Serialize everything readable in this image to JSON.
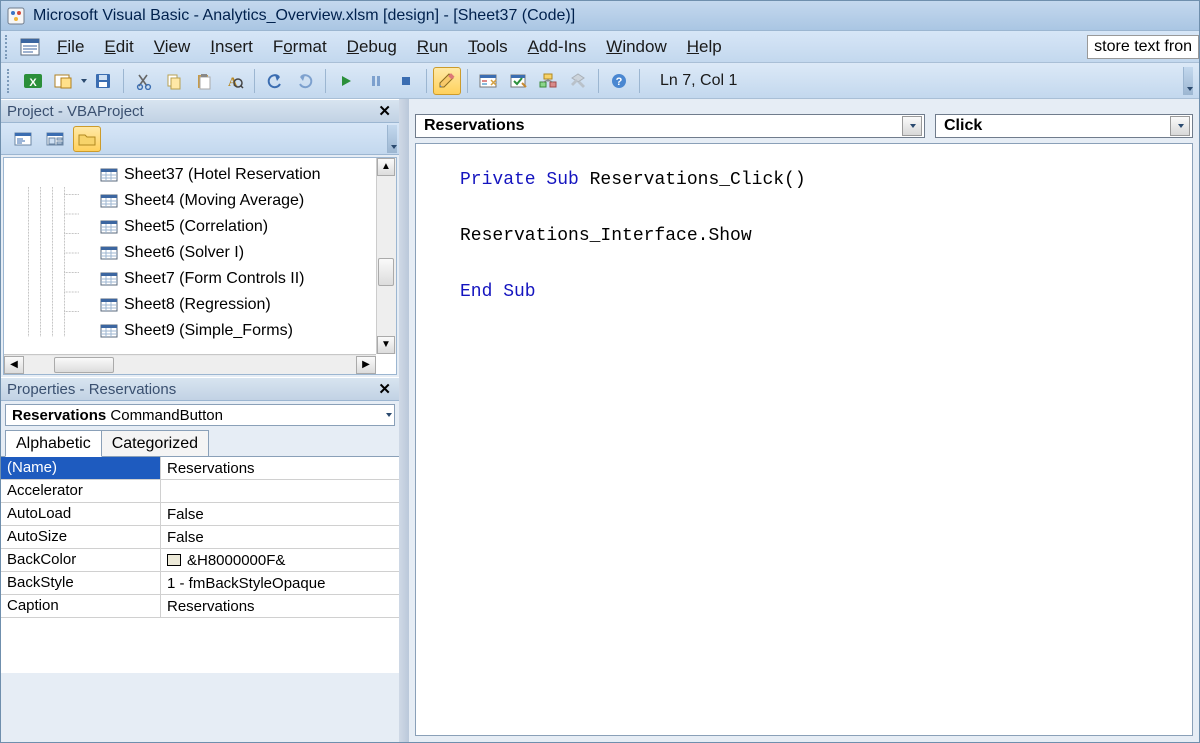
{
  "titlebar": "Microsoft Visual Basic - Analytics_Overview.xlsm [design] - [Sheet37 (Code)]",
  "menus": {
    "file": "File",
    "edit": "Edit",
    "view": "View",
    "insert": "Insert",
    "format": "Format",
    "debug": "Debug",
    "run": "Run",
    "tools": "Tools",
    "addins": "Add-Ins",
    "window": "Window",
    "help": "Help"
  },
  "tooltip_overflow": "store text fron",
  "toolbar_status": "Ln 7, Col 1",
  "project_panel": {
    "title": "Project - VBAProject",
    "items": [
      "Sheet37 (Hotel Reservation",
      "Sheet4 (Moving Average)",
      "Sheet5 (Correlation)",
      "Sheet6 (Solver I)",
      "Sheet7 (Form Controls II)",
      "Sheet8 (Regression)",
      "Sheet9 (Simple_Forms)"
    ]
  },
  "properties_panel": {
    "title": "Properties - Reservations",
    "selector_name": "Reservations",
    "selector_type": "CommandButton",
    "tab_alpha": "Alphabetic",
    "tab_cat": "Categorized",
    "rows": [
      {
        "k": "(Name)",
        "v": "Reservations"
      },
      {
        "k": "Accelerator",
        "v": ""
      },
      {
        "k": "AutoLoad",
        "v": "False"
      },
      {
        "k": "AutoSize",
        "v": "False"
      },
      {
        "k": "BackColor",
        "v": "&H8000000F&",
        "swatch": true
      },
      {
        "k": "BackStyle",
        "v": "1 - fmBackStyleOpaque"
      },
      {
        "k": "Caption",
        "v": "Reservations"
      }
    ]
  },
  "code_selectors": {
    "object": "Reservations",
    "procedure": "Click"
  },
  "code": {
    "line1a": "Private Sub",
    "line1b": " Reservations_Click()",
    "line3": "Reservations_Interface.Show",
    "line5": "End Sub"
  }
}
